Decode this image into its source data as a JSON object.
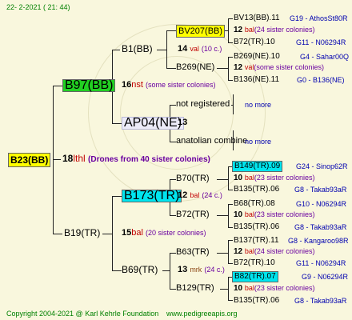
{
  "header": {
    "date": "22-  2-2021 ( 21: 44)"
  },
  "footer": {
    "copyright": "Copyright 2004-2021 @ Karl Kehrle Foundation",
    "url": "www.pedigreeapis.org"
  },
  "colors": {
    "background": "#f9f7dd",
    "yellow_box": "#ffff00",
    "green_box": "#22d022",
    "cyan_box": "#00e5ee",
    "lavender_box": "#ecebf8"
  },
  "root": {
    "name": "B23(BB)",
    "gen": "18",
    "code": "lthl",
    "note": "(Drones from 40 sister colonies)"
  },
  "gen1": {
    "top": {
      "name": "B97(BB)",
      "gen": "16",
      "code": "nst",
      "note": "(some sister colonies)"
    },
    "bottom": {
      "name": "B19(TR)",
      "gen": "15",
      "code": "bal",
      "note": "(20 sister colonies)"
    }
  },
  "gen2": {
    "b1": {
      "name": "B1(BB)",
      "gen": "14",
      "code": "val",
      "note": "(10 c.)"
    },
    "ap04": {
      "name": "AP04(NE)",
      "gen": "13"
    },
    "b173": {
      "name": "B173(TR)",
      "gen": "12",
      "code": "bal",
      "note": "(24 c.)"
    },
    "b69": {
      "name": "B69(TR)",
      "gen": "13",
      "code": "mrk",
      "note": "(24 c.)"
    }
  },
  "gen3": {
    "bv207": {
      "name": "BV207(BB)"
    },
    "b269": {
      "name": "B269(NE)"
    },
    "notreg": {
      "name": "not registered"
    },
    "anat": {
      "name": "anatolian combine"
    },
    "b70": {
      "name": "B70(TR)",
      "gen": "12",
      "code": "bal",
      "note": "(24 c.)"
    },
    "b72": {
      "name": "B72(TR)"
    },
    "b63": {
      "name": "B63(TR)"
    },
    "b129": {
      "name": "B129(TR)"
    }
  },
  "gen4": [
    {
      "s": "BV13(BB).11",
      "sc": "G19 - AthosSt80R",
      "mid": "12",
      "mc": "bal",
      "mn": "(24 sister colonies)",
      "d": "B72(TR).10",
      "dc": "G11 - N06294R"
    },
    {
      "s": "B269(NE).10",
      "sc": "G4 - Sahar00Q",
      "mid": "12",
      "mc": "val",
      "mn": "(some sister colonies)",
      "d": "B136(NE).11",
      "dc": "G0 - B136(NE)"
    },
    {
      "more1": "no more",
      "more2": "no more"
    },
    {
      "s": "B149(TR).09",
      "sc": "G24 - Sinop62R",
      "mid": "10",
      "mc": "bal",
      "mn": "(23 sister colonies)",
      "d": "B135(TR).06",
      "dc": "G8 - Takab93aR"
    },
    {
      "s": "B68(TR).08",
      "sc": "G10 - N06294R",
      "mid": "10",
      "mc": "bal",
      "mn": "(23 sister colonies)",
      "d": "B135(TR).06",
      "dc": "G8 - Takab93aR"
    },
    {
      "s": "B137(TR).11",
      "sc": "G8 - Kangaroo98R",
      "mid": "12",
      "mc": "bal",
      "mn": "(24 sister colonies)",
      "d": "B72(TR).10",
      "dc": "G11 - N06294R"
    },
    {
      "s": "B82(TR).07",
      "sc": "G9 - N06294R",
      "mid": "10",
      "mc": "bal",
      "mn": "(23 sister colonies)",
      "d": "B135(TR).06",
      "dc": "G8 - Takab93aR"
    }
  ]
}
